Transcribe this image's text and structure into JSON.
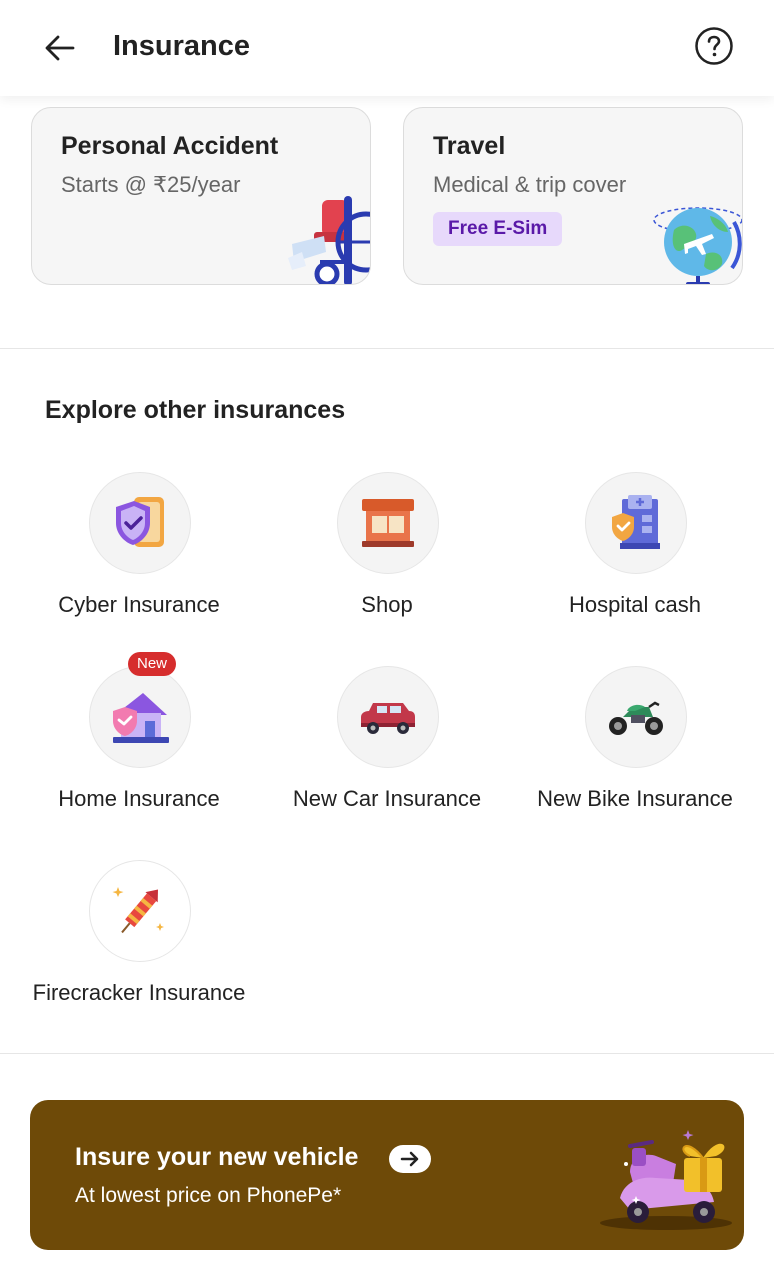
{
  "header": {
    "title": "Insurance",
    "back_icon": "arrow-left-icon",
    "help_icon": "help-circle-icon"
  },
  "featured": [
    {
      "title": "Personal Accident",
      "subtitle": "Starts @ ₹25/year",
      "icon": "wheelchair-icon"
    },
    {
      "title": "Travel",
      "subtitle": "Medical & trip cover",
      "badge": "Free E-Sim",
      "icon": "globe-plane-icon"
    }
  ],
  "explore": {
    "title": "Explore other insurances",
    "items": [
      {
        "label": "Cyber Insurance",
        "icon": "cyber-shield-phone-icon"
      },
      {
        "label": "Shop",
        "icon": "shop-icon"
      },
      {
        "label": "Hospital cash",
        "icon": "hospital-cash-icon"
      },
      {
        "label": "Home Insurance",
        "icon": "home-shield-icon",
        "badge": "New"
      },
      {
        "label": "New Car Insurance",
        "icon": "car-icon"
      },
      {
        "label": "New Bike Insurance",
        "icon": "bike-icon"
      },
      {
        "label": "Firecracker Insurance",
        "icon": "firecracker-icon"
      }
    ]
  },
  "promo": {
    "title": "Insure your new vehicle",
    "subtitle": "At lowest price on PhonePe*",
    "arrow_icon": "arrow-right-circle-icon",
    "art_icon": "scooter-gift-icon"
  },
  "colors": {
    "accent_purple": "#5a19a8",
    "badge_bg": "#e7d9fb",
    "new_badge": "#d62d2d",
    "promo_bg": "#6e4a08"
  }
}
